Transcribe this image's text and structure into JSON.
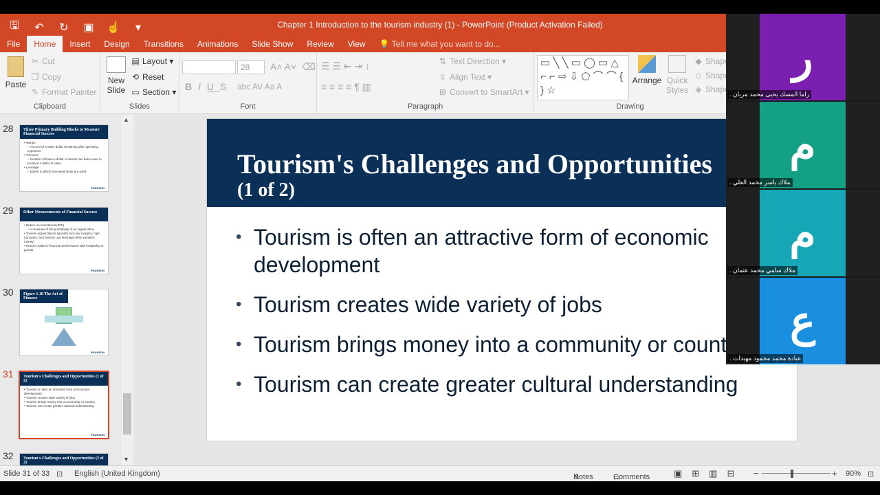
{
  "window": {
    "title": "Chapter 1 Introduction to the tourism industry (1) - PowerPoint (Product Activation Failed)",
    "accent_color": "#d24726"
  },
  "qat": {
    "save_icon": "save-icon",
    "undo_icon": "undo-icon",
    "redo_icon": "repeat-icon"
  },
  "tabs": [
    "File",
    "Home",
    "Insert",
    "Design",
    "Transitions",
    "Animations",
    "Slide Show",
    "Review",
    "View"
  ],
  "tell_me": "Tell me what you want to do...",
  "ribbon": {
    "clipboard": {
      "label": "Clipboard",
      "paste": "Paste",
      "cut": "Cut",
      "copy": "Copy",
      "format_painter": "Format Painter"
    },
    "slides": {
      "label": "Slides",
      "new_slide": "New Slide",
      "layout": "Layout",
      "reset": "Reset",
      "section": "Section"
    },
    "font": {
      "label": "Font",
      "font_size": "28"
    },
    "paragraph": {
      "label": "Paragraph",
      "text_direction": "Text Direction",
      "align_text": "Align Text",
      "convert_smartart": "Convert to SmartArt"
    },
    "drawing": {
      "label": "Drawing",
      "arrange": "Arrange",
      "quick_styles": "Quick Styles",
      "shape1": "Shape",
      "shape2": "Shape",
      "shape3": "Shape"
    }
  },
  "thumbnails": [
    {
      "num": "28",
      "title": "Three Primary Building Blocks to Measure Financial Success",
      "lines": [
        "• Margin",
        "– Amount of a sales dollar remaining after operating expenses",
        "• Turnover",
        "– Number of times a dollar of assets has been used to produce a dollar of sales",
        "• Leverage",
        "– Extent to which borrowed funds are used"
      ],
      "foot": "PEARSON"
    },
    {
      "num": "29",
      "title": "Other Measurements of Financial Success",
      "lines": [
        "• Return on Investment (ROI)",
        "– A measure of the profitability of an organization",
        "• Tourism organizations typically face low margins, high turnovers, and need to use leverage (other people's money)",
        "• Need to balance financial performance with hospitality to guests"
      ],
      "foot": "PEARSON"
    },
    {
      "num": "30",
      "title": "Figure 1.10 The Art of Finance",
      "lines": [],
      "foot": "PEARSON"
    },
    {
      "num": "31",
      "title": "Tourism's Challenges and Opportunities (1 of 2)",
      "lines": [
        "• Tourism is often an attractive form of economic development",
        "• Tourism creates wide variety of jobs",
        "• Tourism brings money into a community or country",
        "• Tourism can create greater cultural understanding"
      ],
      "foot": "PEARSON"
    },
    {
      "num": "32",
      "title": "Tourism's Challenges and Opportunities (2 of 2)",
      "lines": [],
      "foot": ""
    }
  ],
  "slide": {
    "title": "Tourism's Challenges and Opportunities",
    "subtitle": "(1 of 2)",
    "bullets": [
      "Tourism is often an attractive form of economic development",
      "Tourism creates wide variety of jobs",
      "Tourism brings money into a community or country",
      "Tourism can create greater cultural understanding"
    ],
    "header_color": "#0a3057"
  },
  "status": {
    "slide_counter": "Slide 31 of 33",
    "language": "English (United Kingdom)",
    "notes": "Notes",
    "comments": "Comments",
    "zoom": "90%"
  },
  "participants": [
    {
      "initial": "ر",
      "name": "راما المسك يحيى محمد مريان .",
      "color": "#7a1fb0"
    },
    {
      "initial": "م",
      "name": "ملاك ياسر محمد العلي .",
      "color": "#14a085"
    },
    {
      "initial": "م",
      "name": "ملاك سامي محمد عثمان .",
      "color": "#16a6b6"
    },
    {
      "initial": "ع",
      "name": "عبادة محمد محمود مهيدات .",
      "color": "#1a8fe0"
    }
  ]
}
